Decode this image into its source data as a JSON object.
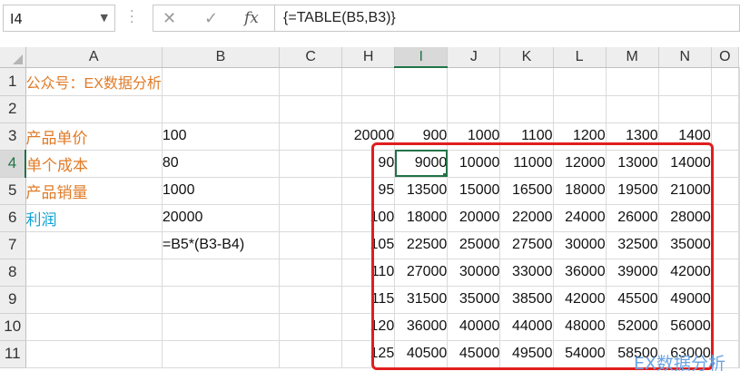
{
  "name_box": {
    "value": "I4"
  },
  "formula_bar": {
    "content": "{=TABLE(B5,B3)}"
  },
  "icons": {
    "cancel": "x-icon",
    "enter": "check-icon",
    "function": "fx-icon",
    "dropdown": "chevron-down-icon",
    "more": "vertical-dots-icon"
  },
  "fx_symbol": "fx",
  "columns": [
    "A",
    "B",
    "C",
    "H",
    "I",
    "J",
    "K",
    "L",
    "M",
    "N",
    "O"
  ],
  "rows": [
    {
      "num": "1",
      "A": "公众号：EX数据分析",
      "B": "",
      "H": "",
      "I": "",
      "J": "",
      "K": "",
      "L": "",
      "M": "",
      "N": ""
    },
    {
      "num": "2",
      "A": "",
      "B": "",
      "H": "",
      "I": "",
      "J": "",
      "K": "",
      "L": "",
      "M": "",
      "N": ""
    },
    {
      "num": "3",
      "A": "产品单价",
      "B": "100",
      "H": "20000",
      "I": "900",
      "J": "1000",
      "K": "1100",
      "L": "1200",
      "M": "1300",
      "N": "1400"
    },
    {
      "num": "4",
      "A": "单个成本",
      "B": "80",
      "H": "90",
      "I": "9000",
      "J": "10000",
      "K": "11000",
      "L": "12000",
      "M": "13000",
      "N": "14000"
    },
    {
      "num": "5",
      "A": "产品销量",
      "B": "1000",
      "H": "95",
      "I": "13500",
      "J": "15000",
      "K": "16500",
      "L": "18000",
      "M": "19500",
      "N": "21000"
    },
    {
      "num": "6",
      "A": "利润",
      "B": "20000",
      "H": "100",
      "I": "18000",
      "J": "20000",
      "K": "22000",
      "L": "24000",
      "M": "26000",
      "N": "28000"
    },
    {
      "num": "7",
      "A": "",
      "B": "=B5*(B3-B4)",
      "H": "105",
      "I": "22500",
      "J": "25000",
      "K": "27500",
      "L": "30000",
      "M": "32500",
      "N": "35000"
    },
    {
      "num": "8",
      "A": "",
      "B": "",
      "H": "110",
      "I": "27000",
      "J": "30000",
      "K": "33000",
      "L": "36000",
      "M": "39000",
      "N": "42000"
    },
    {
      "num": "9",
      "A": "",
      "B": "",
      "H": "115",
      "I": "31500",
      "J": "35000",
      "K": "38500",
      "L": "42000",
      "M": "45500",
      "N": "49000"
    },
    {
      "num": "10",
      "A": "",
      "B": "",
      "H": "120",
      "I": "36000",
      "J": "40000",
      "K": "44000",
      "L": "48000",
      "M": "52000",
      "N": "56000"
    },
    {
      "num": "11",
      "A": "",
      "B": "",
      "H": "125",
      "I": "40500",
      "J": "45000",
      "K": "49500",
      "L": "54000",
      "M": "58500",
      "N": "63000"
    }
  ],
  "watermark": "EX数据分析",
  "colors": {
    "label_orange": "#e07b27",
    "label_blue": "#13a1d6",
    "highlight_red": "#e01e1e",
    "selection_green": "#217346"
  }
}
